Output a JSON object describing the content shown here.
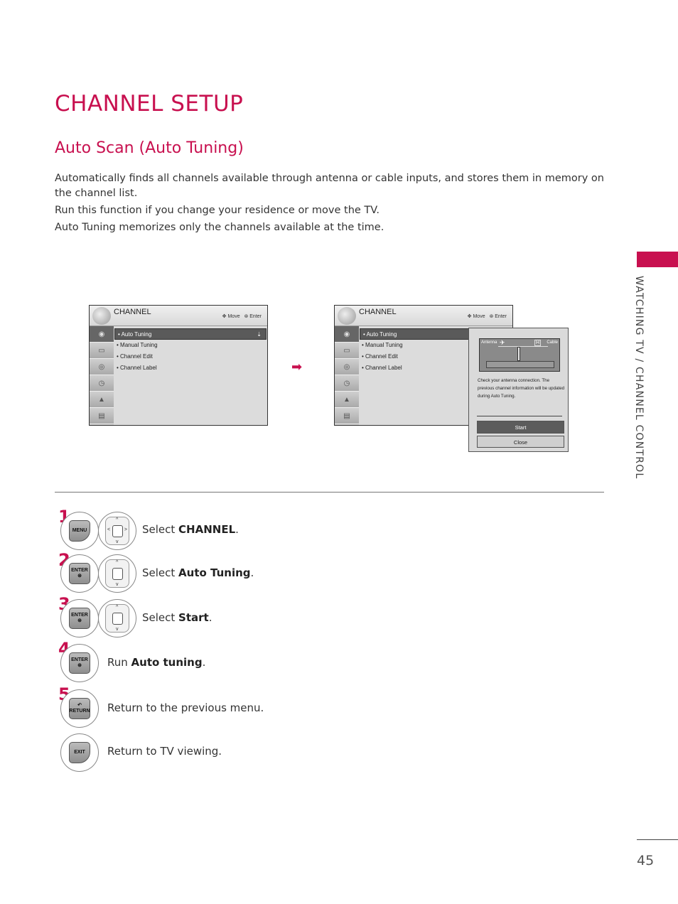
{
  "page": {
    "title": "CHANNEL SETUP",
    "section_title": "Auto Scan (Auto Tuning)",
    "intro": [
      "Automatically finds all channels available through antenna or cable inputs, and stores them in memory on the channel list.",
      "Run this function if you change your residence or move the TV.",
      "Auto Tuning memorizes only the channels available at the time."
    ],
    "side_label": "WATCHING TV / CHANNEL CONTROL",
    "page_number": "45",
    "accent_color": "#c8104f"
  },
  "tv_menu": {
    "title": "CHANNEL",
    "hint_move": "Move",
    "hint_enter": "Enter",
    "items": [
      "Auto Tuning",
      "Manual Tuning",
      "Channel Edit",
      "Channel Label"
    ],
    "selected": "Auto Tuning",
    "side_icons": [
      "channel-icon",
      "picture-icon",
      "audio-icon",
      "time-icon",
      "lock-icon",
      "option-icon"
    ]
  },
  "popup": {
    "label_antenna": "Antenna",
    "label_cable": "Cable",
    "message": "Check your antenna connection. The previous channel information will be updated during Auto Tuning.",
    "start_label": "Start",
    "close_label": "Close"
  },
  "steps": [
    {
      "num": "1",
      "keys": [
        "MENU"
      ],
      "prefix": "Select ",
      "bold": "CHANNEL",
      "suffix": "."
    },
    {
      "num": "2",
      "keys": [
        "ENTER"
      ],
      "prefix": "Select ",
      "bold": "Auto Tuning",
      "suffix": "."
    },
    {
      "num": "3",
      "keys": [
        "ENTER"
      ],
      "prefix": "Select ",
      "bold": "Start",
      "suffix": "."
    },
    {
      "num": "4",
      "keys": [
        "ENTER"
      ],
      "prefix": "Run ",
      "bold": "Auto tuning",
      "suffix": "."
    },
    {
      "num": "5",
      "keys": [
        "RETURN"
      ],
      "prefix": "Return to the previous menu.",
      "bold": "",
      "suffix": ""
    },
    {
      "num": "",
      "keys": [
        "EXIT"
      ],
      "prefix": "Return to TV viewing.",
      "bold": "",
      "suffix": ""
    }
  ]
}
